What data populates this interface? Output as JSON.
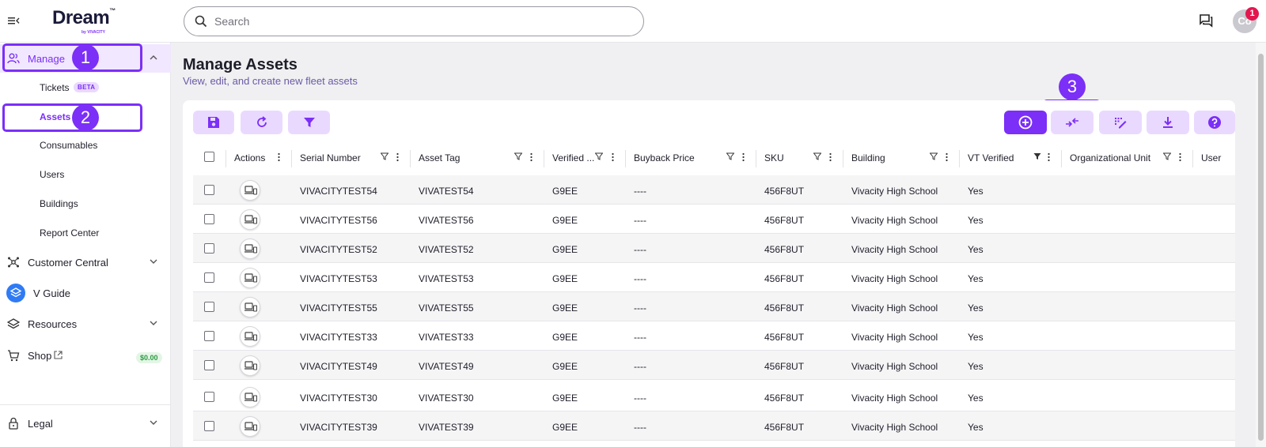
{
  "app": {
    "logo": "Dream",
    "logo_tm": "™",
    "logo_sub": "by VIVACITY"
  },
  "topbar": {
    "search_placeholder": "Search",
    "avatar_initials": "Co",
    "notification_count": "1"
  },
  "sidebar": {
    "manage_label": "Manage",
    "sub_items": [
      "Tickets",
      "Assets",
      "Consumables",
      "Users",
      "Buildings",
      "Report Center"
    ],
    "beta_label": "BETA",
    "customer_central": "Customer Central",
    "v_guide": "V Guide",
    "resources": "Resources",
    "shop": "Shop",
    "shop_price": "$0.00",
    "legal": "Legal"
  },
  "callouts": [
    "1",
    "2",
    "3"
  ],
  "page": {
    "title": "Manage Assets",
    "subtitle": "View, edit, and create new fleet assets"
  },
  "table": {
    "columns": [
      "Actions",
      "Serial Number",
      "Asset Tag",
      "Verified ...",
      "Buyback Price",
      "SKU",
      "Building",
      "VT Verified",
      "Organizational Unit",
      "User"
    ],
    "rows": [
      {
        "serial": "VIVACITYTEST54",
        "tag": "VIVATEST54",
        "verified": "G9EE",
        "buyback": "----",
        "sku": "456F8UT",
        "building": "Vivacity High School",
        "vt": "Yes"
      },
      {
        "serial": "VIVACITYTEST56",
        "tag": "VIVATEST56",
        "verified": "G9EE",
        "buyback": "----",
        "sku": "456F8UT",
        "building": "Vivacity High School",
        "vt": "Yes"
      },
      {
        "serial": "VIVACITYTEST52",
        "tag": "VIVATEST52",
        "verified": "G9EE",
        "buyback": "----",
        "sku": "456F8UT",
        "building": "Vivacity High School",
        "vt": "Yes"
      },
      {
        "serial": "VIVACITYTEST53",
        "tag": "VIVATEST53",
        "verified": "G9EE",
        "buyback": "----",
        "sku": "456F8UT",
        "building": "Vivacity High School",
        "vt": "Yes"
      },
      {
        "serial": "VIVACITYTEST55",
        "tag": "VIVATEST55",
        "verified": "G9EE",
        "buyback": "----",
        "sku": "456F8UT",
        "building": "Vivacity High School",
        "vt": "Yes"
      },
      {
        "serial": "VIVACITYTEST33",
        "tag": "VIVATEST33",
        "verified": "G9EE",
        "buyback": "----",
        "sku": "456F8UT",
        "building": "Vivacity High School",
        "vt": "Yes"
      },
      {
        "serial": "VIVACITYTEST49",
        "tag": "VIVATEST49",
        "verified": "G9EE",
        "buyback": "----",
        "sku": "456F8UT",
        "building": "Vivacity High School",
        "vt": "Yes"
      },
      {
        "serial": "VIVACITYTEST30",
        "tag": "VIVATEST30",
        "verified": "G9EE",
        "buyback": "----",
        "sku": "456F8UT",
        "building": "Vivacity High School",
        "vt": "Yes"
      },
      {
        "serial": "VIVACITYTEST39",
        "tag": "VIVATEST39",
        "verified": "G9EE",
        "buyback": "----",
        "sku": "456F8UT",
        "building": "Vivacity High School",
        "vt": "Yes"
      }
    ]
  },
  "colors": {
    "accent": "#7b2ff7",
    "accent_light": "#ead9ff",
    "badge": "#e3174f"
  }
}
